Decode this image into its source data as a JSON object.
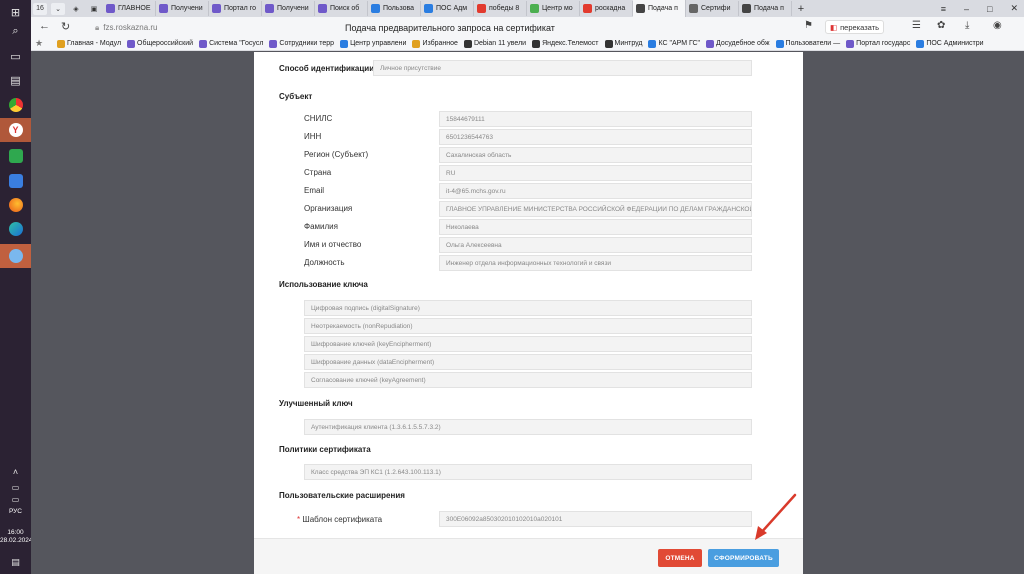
{
  "taskbar": {
    "lang": "РУС",
    "time": "16:00",
    "date": "28.02.2024"
  },
  "browser": {
    "tab_count": "16",
    "tabs": [
      {
        "label": "ГЛАВНОЕ",
        "color": "#6f59c9"
      },
      {
        "label": "Получени",
        "color": "#6f59c9"
      },
      {
        "label": "Портал го",
        "color": "#6f59c9"
      },
      {
        "label": "Получени",
        "color": "#6f59c9"
      },
      {
        "label": "Поиск об",
        "color": "#6f59c9"
      },
      {
        "label": "Пользова",
        "color": "#2a7de1"
      },
      {
        "label": "ПОС Адм",
        "color": "#2a7de1"
      },
      {
        "label": "победы 8",
        "color": "#e23a2e"
      },
      {
        "label": "Центр мо",
        "color": "#4caf50"
      },
      {
        "label": "роскадна",
        "color": "#e23a2e"
      },
      {
        "label": "Подача п",
        "color": "#444444"
      },
      {
        "label": "Сертифи",
        "color": "#666666"
      },
      {
        "label": "Подача п",
        "color": "#444444"
      }
    ],
    "url": "fzs.roskazna.ru",
    "page_title": "Подача предварительного запроса на сертификат",
    "translate_label": "переказать",
    "bookmarks": [
      {
        "label": "Главная - Модул",
        "color": "#e0a020"
      },
      {
        "label": "Общероссийский",
        "color": "#6f59c9"
      },
      {
        "label": "Система \"Госусл",
        "color": "#6f59c9"
      },
      {
        "label": "Сотрудники терр",
        "color": "#6f59c9"
      },
      {
        "label": "Центр управлени",
        "color": "#2a7de1"
      },
      {
        "label": "Избранное",
        "color": "#e0a020"
      },
      {
        "label": "Debian 11 увели",
        "color": "#333333"
      },
      {
        "label": "Яндекс.Телемост",
        "color": "#333333"
      },
      {
        "label": "Минтруд",
        "color": "#333333"
      },
      {
        "label": "КС \"АРМ ГС\"",
        "color": "#2a7de1"
      },
      {
        "label": "Досудебное обж",
        "color": "#6f59c9"
      },
      {
        "label": "Пользователи —",
        "color": "#2a7de1"
      },
      {
        "label": "Портал государс",
        "color": "#6f59c9"
      },
      {
        "label": "ПОС Администри",
        "color": "#2a7de1"
      }
    ]
  },
  "form": {
    "ident": {
      "label": "Способ идентификации",
      "value": "Личное присутствие"
    },
    "subject": {
      "title": "Субъект",
      "fields": [
        {
          "label": "СНИЛС",
          "value": "15844679111"
        },
        {
          "label": "ИНН",
          "value": "6501236544763"
        },
        {
          "label": "Регион (Субъект)",
          "value": "Сахалинская область"
        },
        {
          "label": "Страна",
          "value": "RU"
        },
        {
          "label": "Email",
          "value": "it-4@65.mchs.gov.ru"
        },
        {
          "label": "Организация",
          "value": "ГЛАВНОЕ УПРАВЛЕНИЕ МИНИСТЕРСТВА РОССИЙСКОЙ ФЕДЕРАЦИИ ПО ДЕЛАМ ГРАЖДАНСКОЙ ОБОРОНЫ,"
        },
        {
          "label": "Фамилия",
          "value": "Николаева"
        },
        {
          "label": "Имя и отчество",
          "value": "Ольга Алексеевна"
        },
        {
          "label": "Должность",
          "value": "Инженер отдела информационных технологий и связи"
        }
      ]
    },
    "key_usage": {
      "title": "Использование ключа",
      "items": [
        "Цифровая подпись (digitalSignature)",
        "Неотрекаемость (nonRepudiation)",
        "Шифрование ключей (keyEncipherment)",
        "Шифрование данных (dataEncipherment)",
        "Согласование ключей (keyAgreement)"
      ]
    },
    "ext_key": {
      "title": "Улучшенный ключ",
      "value": "Аутентификация клиента (1.3.6.1.5.5.7.3.2)"
    },
    "policies": {
      "title": "Политики сертификата",
      "value": "Класс средства ЭП КС1 (1.2.643.100.113.1)"
    },
    "custom_ext": {
      "title": "Пользовательские расширения",
      "template_label": "Шаблон сертификата",
      "template_value": "300E06092a850302010102010a020101"
    },
    "buttons": {
      "cancel": "ОТМЕНА",
      "submit": "СФОРМИРОВАТЬ"
    }
  }
}
